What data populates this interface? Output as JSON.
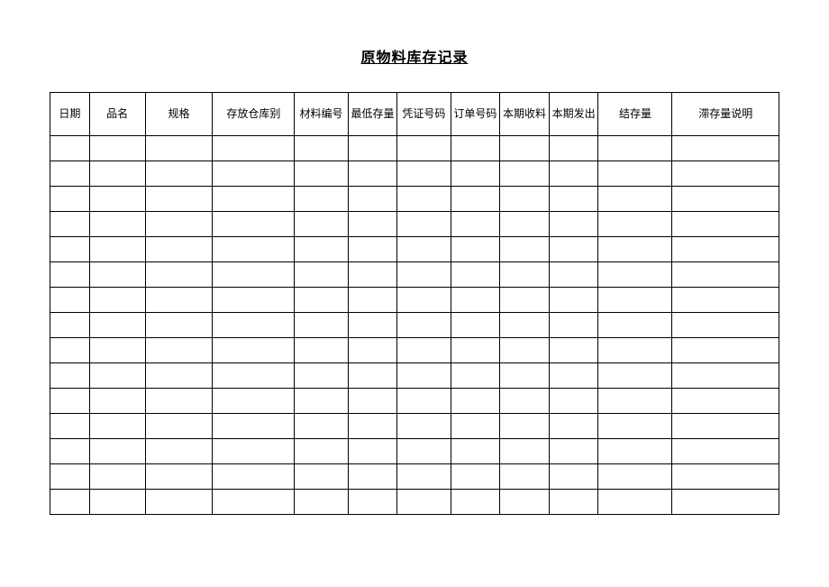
{
  "title": "原物料库存记录",
  "headers": {
    "date": "日期",
    "name": "品名",
    "spec": "规格",
    "warehouse": "存放仓库别",
    "material": "材料编号",
    "minstock": "最低存量",
    "voucher": "凭证号码",
    "order": "订单号码",
    "receive": "本期收料",
    "issue": "本期发出",
    "balance": "结存量",
    "overstock": "滞存量说明"
  },
  "rows": [
    [
      "",
      "",
      "",
      "",
      "",
      "",
      "",
      "",
      "",
      "",
      "",
      ""
    ],
    [
      "",
      "",
      "",
      "",
      "",
      "",
      "",
      "",
      "",
      "",
      "",
      ""
    ],
    [
      "",
      "",
      "",
      "",
      "",
      "",
      "",
      "",
      "",
      "",
      "",
      ""
    ],
    [
      "",
      "",
      "",
      "",
      "",
      "",
      "",
      "",
      "",
      "",
      "",
      ""
    ],
    [
      "",
      "",
      "",
      "",
      "",
      "",
      "",
      "",
      "",
      "",
      "",
      ""
    ],
    [
      "",
      "",
      "",
      "",
      "",
      "",
      "",
      "",
      "",
      "",
      "",
      ""
    ],
    [
      "",
      "",
      "",
      "",
      "",
      "",
      "",
      "",
      "",
      "",
      "",
      ""
    ],
    [
      "",
      "",
      "",
      "",
      "",
      "",
      "",
      "",
      "",
      "",
      "",
      ""
    ],
    [
      "",
      "",
      "",
      "",
      "",
      "",
      "",
      "",
      "",
      "",
      "",
      ""
    ],
    [
      "",
      "",
      "",
      "",
      "",
      "",
      "",
      "",
      "",
      "",
      "",
      ""
    ],
    [
      "",
      "",
      "",
      "",
      "",
      "",
      "",
      "",
      "",
      "",
      "",
      ""
    ],
    [
      "",
      "",
      "",
      "",
      "",
      "",
      "",
      "",
      "",
      "",
      "",
      ""
    ],
    [
      "",
      "",
      "",
      "",
      "",
      "",
      "",
      "",
      "",
      "",
      "",
      ""
    ],
    [
      "",
      "",
      "",
      "",
      "",
      "",
      "",
      "",
      "",
      "",
      "",
      ""
    ],
    [
      "",
      "",
      "",
      "",
      "",
      "",
      "",
      "",
      "",
      "",
      "",
      ""
    ]
  ]
}
